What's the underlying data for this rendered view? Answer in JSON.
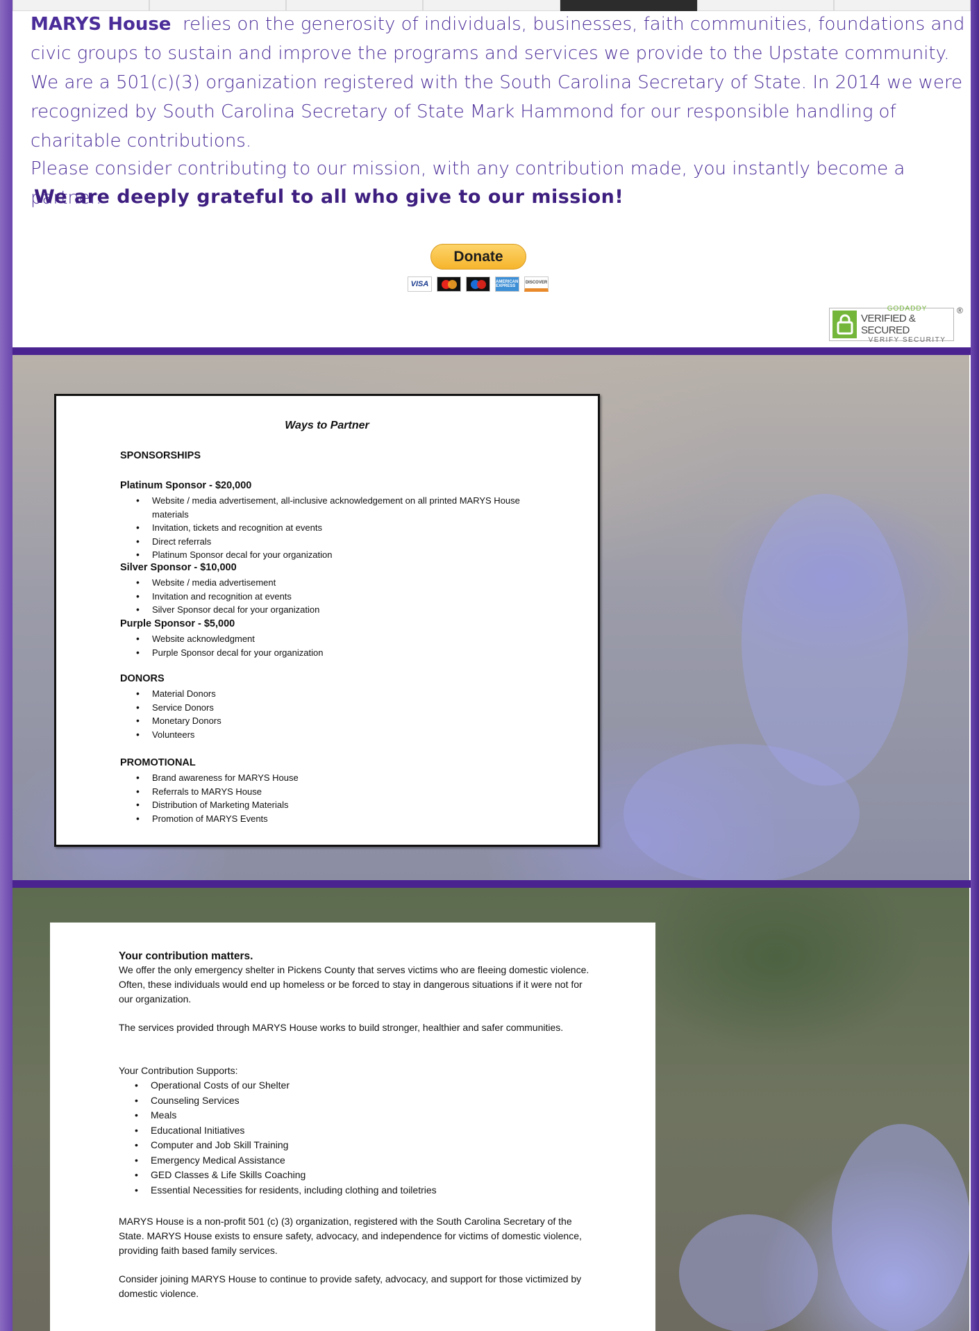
{
  "nav": {
    "tab_count": 7,
    "active_tab_index": 4
  },
  "intro": {
    "org_name": "MARYS House",
    "paragraph1": "relies on the generosity of individuals, businesses, faith communities, foundations and civic groups to sustain and improve the programs and services we provide to the Upstate community.  We are a 501(c)(3) organization registered with the South Carolina Secretary of State.  In 2014 we were recognized by South Carolina Secretary of State Mark Hammond for our responsible handling of charitable contributions.",
    "paragraph2": "Please consider contributing to our mission, with any contribution made, you instantly become a partner.",
    "grateful": "We are deeply grateful to all who give to our mission!"
  },
  "donate": {
    "label": "Donate",
    "cards": [
      "VISA",
      "Mastercard",
      "Maestro",
      "AMERICAN EXPRESS",
      "DISCOVER"
    ]
  },
  "godaddy_seal": {
    "brand": "GODADDY",
    "main": "VERIFIED & SECURED",
    "verify": "VERIFY SECURITY",
    "reg": "®"
  },
  "colors": {
    "brand_purple": "#4a2390",
    "text_purple": "#4b2d99",
    "donate_yellow": "#fdd46a"
  },
  "partner_doc": {
    "title": "Ways to Partner",
    "sponsorships_heading": "SPONSORSHIPS",
    "platinum": {
      "heading": "Platinum Sponsor - $20,000",
      "items": [
        "Website / media advertisement, all-inclusive acknowledgement on all printed MARYS House materials",
        "Invitation, tickets and recognition at events",
        "Direct referrals",
        "Platinum Sponsor decal for your organization"
      ]
    },
    "silver": {
      "heading": "Silver Sponsor - $10,000",
      "items": [
        "Website / media advertisement",
        "Invitation and recognition at events",
        "Silver Sponsor decal for your organization"
      ]
    },
    "purple": {
      "heading": "Purple Sponsor - $5,000",
      "items": [
        "Website acknowledgment",
        "Purple Sponsor decal for your organization"
      ]
    },
    "donors": {
      "heading": "DONORS",
      "items": [
        "Material Donors",
        "Service Donors",
        "Monetary Donors",
        "Volunteers"
      ]
    },
    "promotional": {
      "heading": "PROMOTIONAL",
      "items": [
        "Brand awareness for MARYS House",
        "Referrals to MARYS House",
        "Distribution of Marketing Materials",
        "Promotion of MARYS Events"
      ]
    }
  },
  "contribution_doc": {
    "heading": "Your contribution matters.",
    "p1": "We offer the only emergency shelter in Pickens County that serves victims who are fleeing domestic violence. Often, these individuals would end up homeless or be forced to stay in dangerous situations if it were not for our organization.",
    "p2": "The services provided through MARYS House works to build stronger, healthier and safer communities.",
    "supports_heading": "Your Contribution Supports:",
    "supports": [
      "Operational Costs of our Shelter",
      "Counseling Services",
      "Meals",
      "Educational Initiatives",
      "Computer and Job Skill Training",
      "Emergency Medical Assistance",
      "GED Classes & Life Skills Coaching",
      "Essential Necessities for residents, including clothing and toiletries"
    ],
    "p3": "MARYS House is a non-profit 501 (c) (3) organization, registered with the South Carolina Secretary of the State. MARYS House exists to ensure safety, advocacy, and independence for victims of domestic violence, providing faith based family services.",
    "p4": "Consider joining MARYS House to continue to provide safety, advocacy, and support for those victimized by domestic violence."
  }
}
